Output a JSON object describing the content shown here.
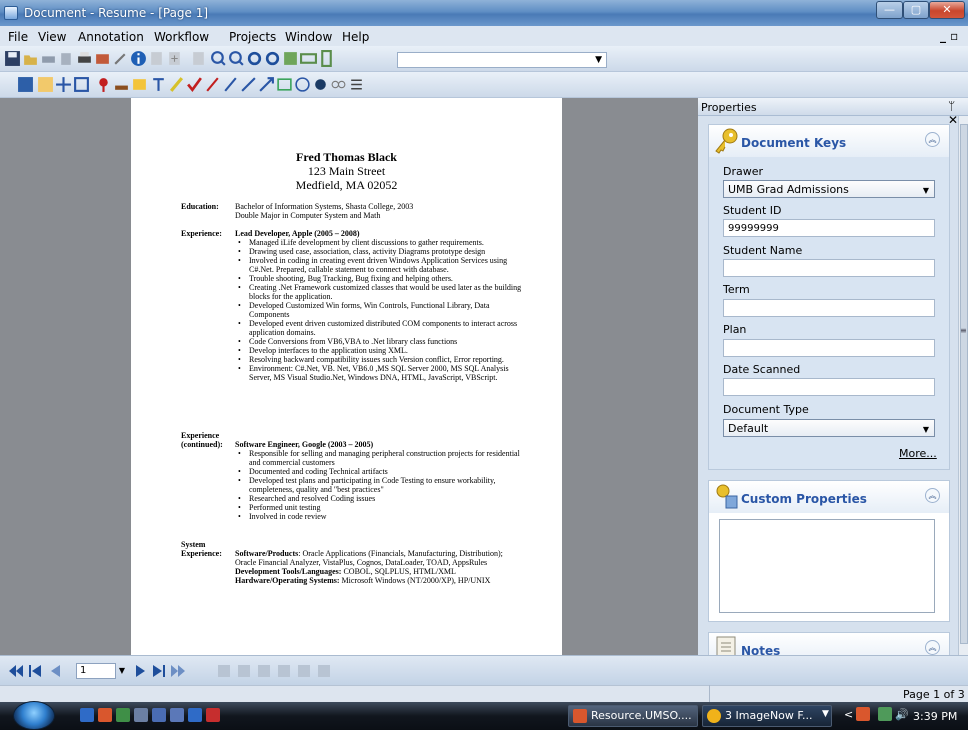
{
  "window": {
    "title": "Document - Resume - [Page 1]"
  },
  "menu": [
    "File",
    "View",
    "Annotation",
    "Workflow",
    "Projects",
    "Window",
    "Help"
  ],
  "document": {
    "name": "Fred Thomas Black",
    "address1": "123 Main Street",
    "address2": "Medfield, MA 02052",
    "education_label": "Education:",
    "education_lines": [
      "Bachelor of Information Systems, Shasta College, 2003",
      "Double Major in Computer System and Math"
    ],
    "experience_label": "Experience:",
    "job1": "Lead Developer, Apple (2005 – 2008)",
    "job1_bullets": [
      "Managed iLife development by client discussions to gather requirements.",
      "Drawing used case, association, class, activity Diagrams prototype design",
      "Involved in coding in creating event driven Windows Application Services using C#.Net. Prepared, callable statement to connect with database.",
      "Trouble shooting, Bug Tracking, Bug fixing and helping others.",
      "Creating .Net Framework customized classes that would be used later as the building blocks for the application.",
      "Developed Customized Win forms, Win Controls, Functional Library, Data Components",
      "Developed event driven customized distributed COM components to interact across application domains.",
      "Code Conversions from VB6,VBA to .Net library class functions",
      "Develop interfaces to the application using XML.",
      "Resolving backward compatibility issues such Version conflict, Error reporting.",
      "Environment: C#.Net, VB. Net, VB6.0 ,MS SQL Server 2000, MS SQL Analysis Server, MS Visual Studio.Net, Windows DNA, HTML, JavaScript, VBScript."
    ],
    "experience_cont_label1": "Experience",
    "experience_cont_label2": "(continued):",
    "job2": "Software Engineer, Google (2003 – 2005)",
    "job2_bullets": [
      "Responsible for selling and managing peripheral construction projects for residential and commercial customers",
      "Documented and coding Technical artifacts",
      "Developed test plans and participating in Code Testing to ensure workability, completeness, quality and \"best practices\"",
      "Researched and resolved Coding issues",
      "Performed unit testing",
      "Involved in code review"
    ],
    "system_label1": "System",
    "system_label2": "Experience:",
    "sw_title": "Software/Products",
    "sw_text": ": Oracle Applications (Financials, Manufacturing, Distribution); Oracle Financial Analyzer, VistaPlus, Cognos, DataLoader, TOAD, AppsRules",
    "dev_title": "Development Tools/Languages:",
    "dev_text": " COBOL, SQLPLUS, HTML/XML",
    "hw_title": "Hardware/Operating Systems:",
    "hw_text": " Microsoft Windows (NT/2000/XP), HP/UNIX"
  },
  "properties": {
    "header": "Properties",
    "pin": "ᛘ ✕",
    "keys_title": "Document Keys",
    "drawer_label": "Drawer",
    "drawer_value": "UMB Grad Admissions",
    "student_id_label": "Student ID",
    "student_id_value": "99999999",
    "student_name_label": "Student Name",
    "term_label": "Term",
    "plan_label": "Plan",
    "date_scanned_label": "Date Scanned",
    "doc_type_label": "Document Type",
    "doc_type_value": "Default",
    "more_link": "More...",
    "custom_title": "Custom Properties",
    "notes_title": "Notes"
  },
  "nav": {
    "page_input": "1"
  },
  "status": {
    "page": "Page 1 of 3"
  },
  "taskbar": {
    "btn1": "Resource.UMSO....",
    "btn2": "3 ImageNow F...",
    "time": "3:39 PM"
  },
  "colors": {
    "accent": "#2a56a6",
    "titlebar": "#5f8ec4",
    "doc_bg": "#898c91"
  }
}
